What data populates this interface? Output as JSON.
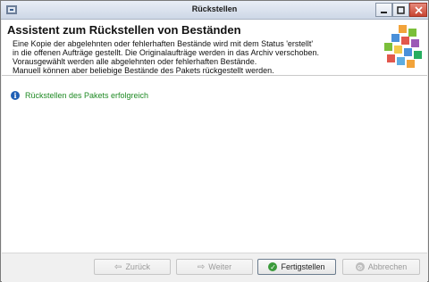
{
  "window": {
    "title": "Rückstellen"
  },
  "header": {
    "title": "Assistent zum Rückstellen von Beständen",
    "description_lines": [
      "Eine Kopie der abgelehnten oder fehlerhaften Bestände wird mit dem Status 'erstellt'",
      "in die offenen Aufträge gestellt. Die Originalaufträge werden in das Archiv verschoben.",
      "Vorausgewählt werden alle abgelehnten oder fehlerhaften Bestände.",
      "Manuell können aber beliebige Bestände des Pakets rückgestellt werden."
    ]
  },
  "status": {
    "message": "Rückstellen des Pakets erfolgreich",
    "icon": "info-icon",
    "color": "#1f8a24"
  },
  "buttons": {
    "back": "Zurück",
    "next": "Weiter",
    "finish": "Fertigstellen",
    "cancel": "Abbrechen"
  },
  "colors": {
    "close_button": "#c84532",
    "info_icon": "#1f5fb5"
  }
}
